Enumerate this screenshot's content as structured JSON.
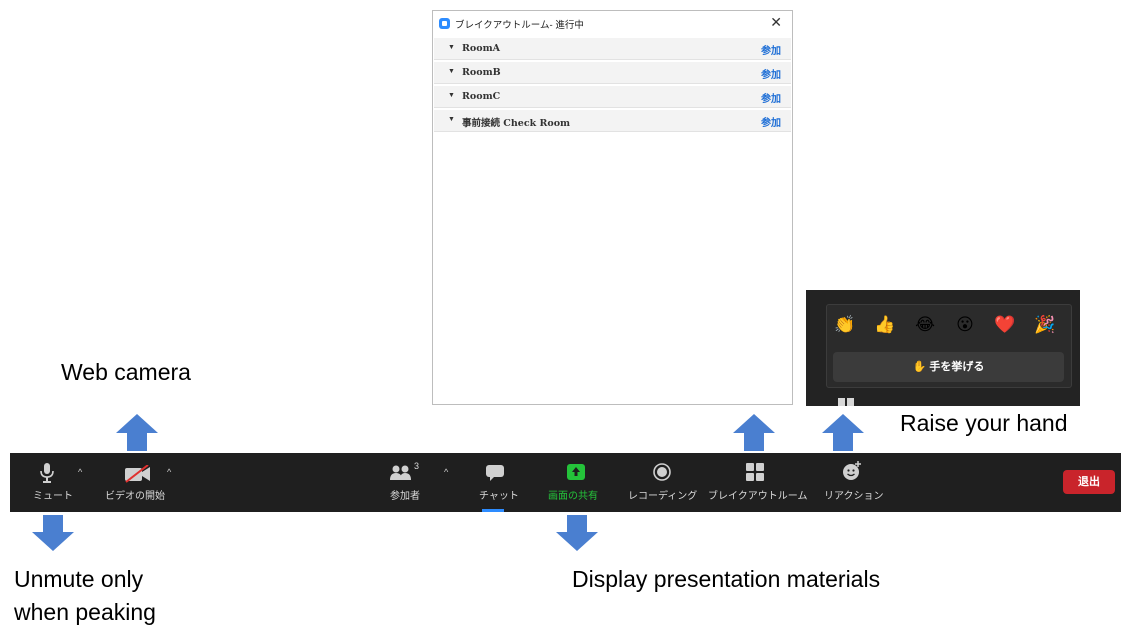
{
  "breakout_window": {
    "title": "ブレイクアウトルーム- 進行中",
    "close_glyph": "✕",
    "rooms": [
      {
        "name": "RoomA",
        "join_label": "参加"
      },
      {
        "name": "RoomB",
        "join_label": "参加"
      },
      {
        "name": "RoomC",
        "join_label": "参加"
      },
      {
        "name": "事前接続 Check Room",
        "join_label": "参加"
      }
    ],
    "caret_glyph": "▼"
  },
  "reactions_popup": {
    "emojis": [
      "👏",
      "👍",
      "😂",
      "😮",
      "❤️",
      "🎉"
    ],
    "raise_hand_icon": "✋",
    "raise_hand_label": "手を挙げる"
  },
  "toolbar": {
    "mute_label": "ミュート",
    "video_label": "ビデオの開始",
    "participants_label": "参加者",
    "participants_count": "3",
    "chat_label": "チャット",
    "share_label": "画面の共有",
    "record_label": "レコーディング",
    "breakout_label": "ブレイクアウトルーム",
    "reactions_label": "リアクション",
    "leave_label": "退出",
    "caret_glyph": "^",
    "share_color": "#24c33a",
    "leave_color": "#c9242b"
  },
  "annotations": {
    "web_camera": "Web camera",
    "raise_hand": "Raise your hand",
    "unmute_line1": "Unmute only",
    "unmute_line2": "when peaking",
    "display_materials": "Display presentation materials"
  },
  "colors": {
    "arrow": "#4a7fd0",
    "join_link": "#1f6fd6",
    "toolbar_bg": "#1f1f1f"
  }
}
